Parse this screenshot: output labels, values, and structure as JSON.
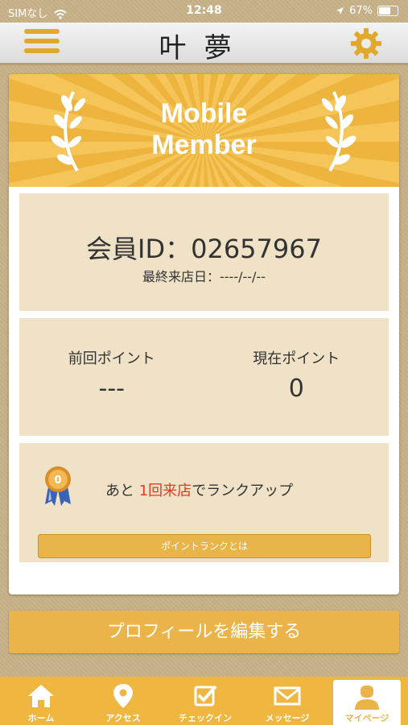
{
  "status_bar": {
    "carrier": "SIMなし",
    "time": "12:48",
    "battery": "67%"
  },
  "header": {
    "logo": "叶夢"
  },
  "banner": {
    "title_line1": "Mobile",
    "title_line2": "Member"
  },
  "member": {
    "id_label": "会員ID：02657967",
    "last_visit": "最終来店日：----/--/--"
  },
  "points": {
    "previous_label": "前回ポイント",
    "previous_value": "---",
    "current_label": "現在ポイント",
    "current_value": "0"
  },
  "rank": {
    "prefix": "あと",
    "highlight": "1回来店",
    "suffix": "でランクアップ",
    "medal_value": "0",
    "button_label": "ポイントランクとは"
  },
  "profile_button": "プロフィールを編集する",
  "tabs": [
    {
      "label": "ホーム",
      "icon": "home-icon"
    },
    {
      "label": "アクセス",
      "icon": "location-pin-icon"
    },
    {
      "label": "チェックイン",
      "icon": "checkin-icon"
    },
    {
      "label": "メッセージ",
      "icon": "envelope-icon"
    },
    {
      "label": "マイページ",
      "icon": "user-icon"
    }
  ],
  "colors": {
    "accent": "#efb640",
    "panel": "#efe2c6",
    "highlight": "#e33a24",
    "background": "#c9b48d"
  }
}
